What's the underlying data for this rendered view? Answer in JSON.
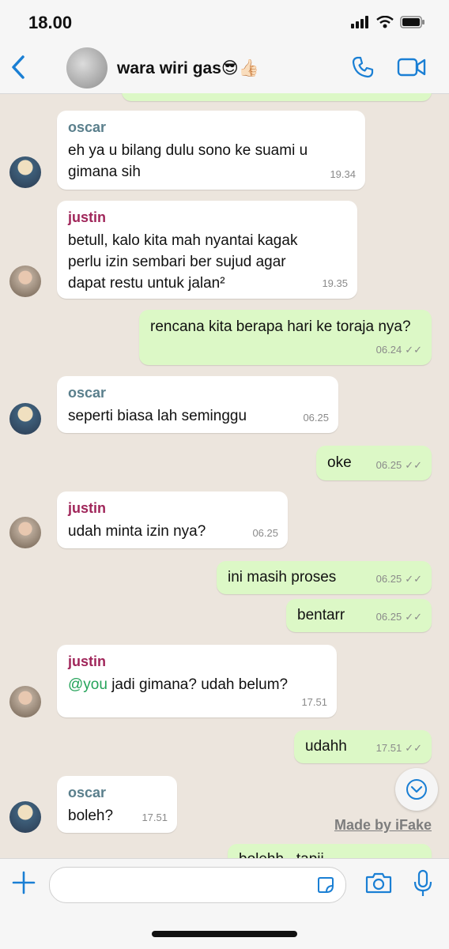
{
  "status_bar": {
    "time": "18.00"
  },
  "header": {
    "group_name": "wara wiri gas😎👍🏻"
  },
  "colors": {
    "accent": "#1a7fd4",
    "incoming": "#ffffff",
    "outgoing": "#dcf8c6",
    "oscar_name": "#5a7f8c",
    "justin_name": "#a0265a",
    "mention": "#25a35a"
  },
  "messages": [
    {
      "sender": "oscar",
      "text": "eh ya u bilang dulu sono ke suami u gimana sih",
      "time": "19.34"
    },
    {
      "sender": "justin",
      "text": "betull, kalo kita mah nyantai kagak perlu izin sembari ber sujud agar dapat restu untuk jalan²",
      "time": "19.35"
    },
    {
      "text": "rencana kita berapa hari ke toraja nya?",
      "time": "06.24"
    },
    {
      "sender": "oscar",
      "text": "seperti biasa lah seminggu",
      "time": "06.25"
    },
    {
      "text": "oke",
      "time": "06.25"
    },
    {
      "sender": "justin",
      "text": "udah minta izin nya?",
      "time": "06.25"
    },
    {
      "text": "ini masih proses",
      "time": "06.25"
    },
    {
      "text": "bentarr",
      "time": "06.25"
    },
    {
      "sender": "justin",
      "mention": "@you",
      "text": "jadi gimana? udah belum?",
      "time": "17.51"
    },
    {
      "text": "udahh",
      "time": "17.51"
    },
    {
      "sender": "oscar",
      "text": "boleh?",
      "time": "17.51"
    },
    {
      "text": "bolehh...tapii"
    }
  ],
  "watermark": "Made by iFake",
  "icons": [
    "back-chevron-icon",
    "phone-icon",
    "video-camera-icon",
    "plus-icon",
    "sticker-icon",
    "camera-icon",
    "microphone-icon",
    "chevron-down-icon",
    "double-check-icon",
    "signal-icon",
    "wifi-icon",
    "battery-icon"
  ]
}
